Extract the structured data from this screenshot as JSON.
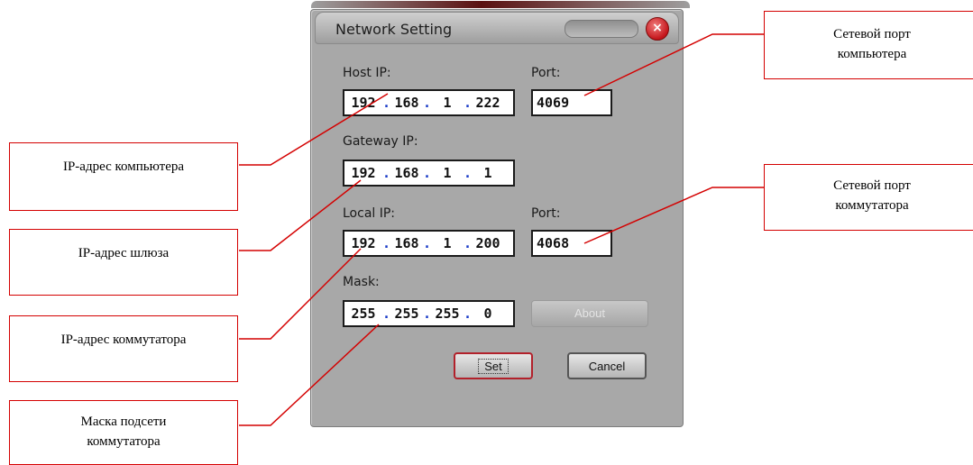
{
  "dialog": {
    "title": "Network Setting",
    "close_label": "×",
    "host_ip": {
      "label": "Host IP:",
      "octets": [
        "192",
        "168",
        "1",
        "222"
      ]
    },
    "host_port": {
      "label": "Port:",
      "value": "4069"
    },
    "gateway_ip": {
      "label": "Gateway IP:",
      "octets": [
        "192",
        "168",
        "1",
        "1"
      ]
    },
    "local_ip": {
      "label": "Local IP:",
      "octets": [
        "192",
        "168",
        "1",
        "200"
      ]
    },
    "local_port": {
      "label": "Port:",
      "value": "4068"
    },
    "mask": {
      "label": "Mask:",
      "octets": [
        "255",
        "255",
        "255",
        "0"
      ]
    },
    "buttons": {
      "about": "About",
      "set": "Set",
      "cancel": "Cancel"
    }
  },
  "callouts": {
    "host_ip": "IP-адрес компьютера",
    "gateway_ip": "IP-адрес шлюза",
    "local_ip": "IP-адрес коммутатора",
    "mask_line1": "Маска подсети",
    "mask_line2": "коммутатора",
    "host_port_line1": "Сетевой порт",
    "host_port_line2": "компьютера",
    "local_port_line1": "Сетевой порт",
    "local_port_line2": "коммутатора"
  },
  "colors": {
    "callout_border": "#d40000",
    "dot": "#1b3cc8",
    "dialog_bg": "#a8a8a8"
  }
}
